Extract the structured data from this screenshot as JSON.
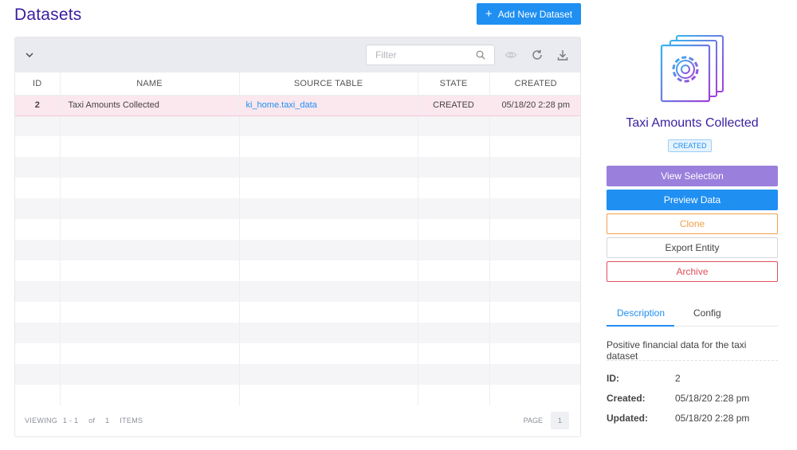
{
  "page": {
    "title": "Datasets",
    "add_button_label": "Add New Dataset"
  },
  "toolbar": {
    "filter_placeholder": "Filter",
    "icons": [
      "chevron-down-icon",
      "search-icon",
      "eye-icon",
      "refresh-icon",
      "download-icon"
    ]
  },
  "table": {
    "columns": [
      "ID",
      "NAME",
      "SOURCE TABLE",
      "STATE",
      "CREATED"
    ],
    "rows": [
      {
        "id": "2",
        "name": "Taxi Amounts Collected",
        "source_table": "ki_home.taxi_data",
        "state": "CREATED",
        "created": "05/18/20 2:28 pm"
      }
    ]
  },
  "footer": {
    "viewing_label": "VIEWING",
    "range": "1 - 1",
    "of_label": "of",
    "total": "1",
    "items_label": "ITEMS",
    "page_label": "PAGE",
    "page_number": "1"
  },
  "detail": {
    "name": "Taxi Amounts Collected",
    "state": "CREATED",
    "actions": {
      "view": "View Selection",
      "preview": "Preview Data",
      "clone": "Clone",
      "export": "Export Entity",
      "archive": "Archive"
    },
    "tabs": {
      "description": "Description",
      "config": "Config"
    },
    "description": "Positive financial data for the taxi dataset",
    "meta": {
      "id_label": "ID:",
      "id_value": "2",
      "created_label": "Created:",
      "created_value": "05/18/20 2:28 pm",
      "updated_label": "Updated:",
      "updated_value": "05/18/20 2:28 pm"
    }
  },
  "colors": {
    "brand_purple": "#3a1fa0",
    "primary_blue": "#1f8ff2",
    "view_purple": "#9b7fdc",
    "clone_orange": "#f0a04b",
    "archive_red": "#e0505c",
    "selected_row": "#fbe7ee"
  }
}
